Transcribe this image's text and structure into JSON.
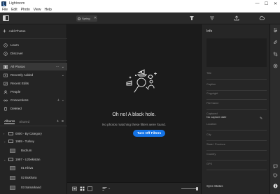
{
  "window": {
    "title": "Lightroom",
    "buttons": [
      "—",
      "☐",
      "✕"
    ]
  },
  "menu": [
    "File",
    "Edit",
    "Photo",
    "View",
    "Help"
  ],
  "toolbar": {
    "search_value": "Spring",
    "search_clear": "✕",
    "icons": [
      "filter-icon",
      "edit-sliders-icon",
      "heal-icon",
      "crop-icon",
      "sort-icon",
      "share-icon",
      "cloud-sync-icon"
    ]
  },
  "sidebar": {
    "add_photos": "Add Photos",
    "learn": "Learn",
    "discover": "Discover",
    "all_photos": "All Photos",
    "recently_added": "Recently Added",
    "recent_edits": "Recent Edits",
    "people": "People",
    "connections": "Connections",
    "deleted": "Deleted",
    "tabs": [
      "Albums",
      "Shared"
    ],
    "albums": [
      {
        "label": "0000 - By Category",
        "type": "folder"
      },
      {
        "label": "1989 - Turkey",
        "type": "folder"
      },
      {
        "label": "Bodrum",
        "type": "album"
      },
      {
        "label": "1997 - Uzbekistan",
        "type": "folder"
      },
      {
        "label": "01 Khiva",
        "type": "album"
      },
      {
        "label": "02 Bukhara",
        "type": "album"
      },
      {
        "label": "03 Samarkand",
        "type": "album"
      }
    ]
  },
  "center": {
    "empty_title": "Oh no! A black hole.",
    "empty_subtitle": "No photos matching these filters were found.",
    "button_label": "Turn Off Filters"
  },
  "info": {
    "header": "Info",
    "fields": [
      "Title",
      "Caption",
      "Copyright",
      "File Name",
      "Captured",
      "Location",
      "City",
      "State / Province",
      "Country",
      "GPS"
    ],
    "captured_value": "No capture date",
    "sync_status": "Sync Status"
  },
  "colors": {
    "accent": "#1473e6",
    "bg": "#1b1b1b",
    "panel": "#262626"
  }
}
